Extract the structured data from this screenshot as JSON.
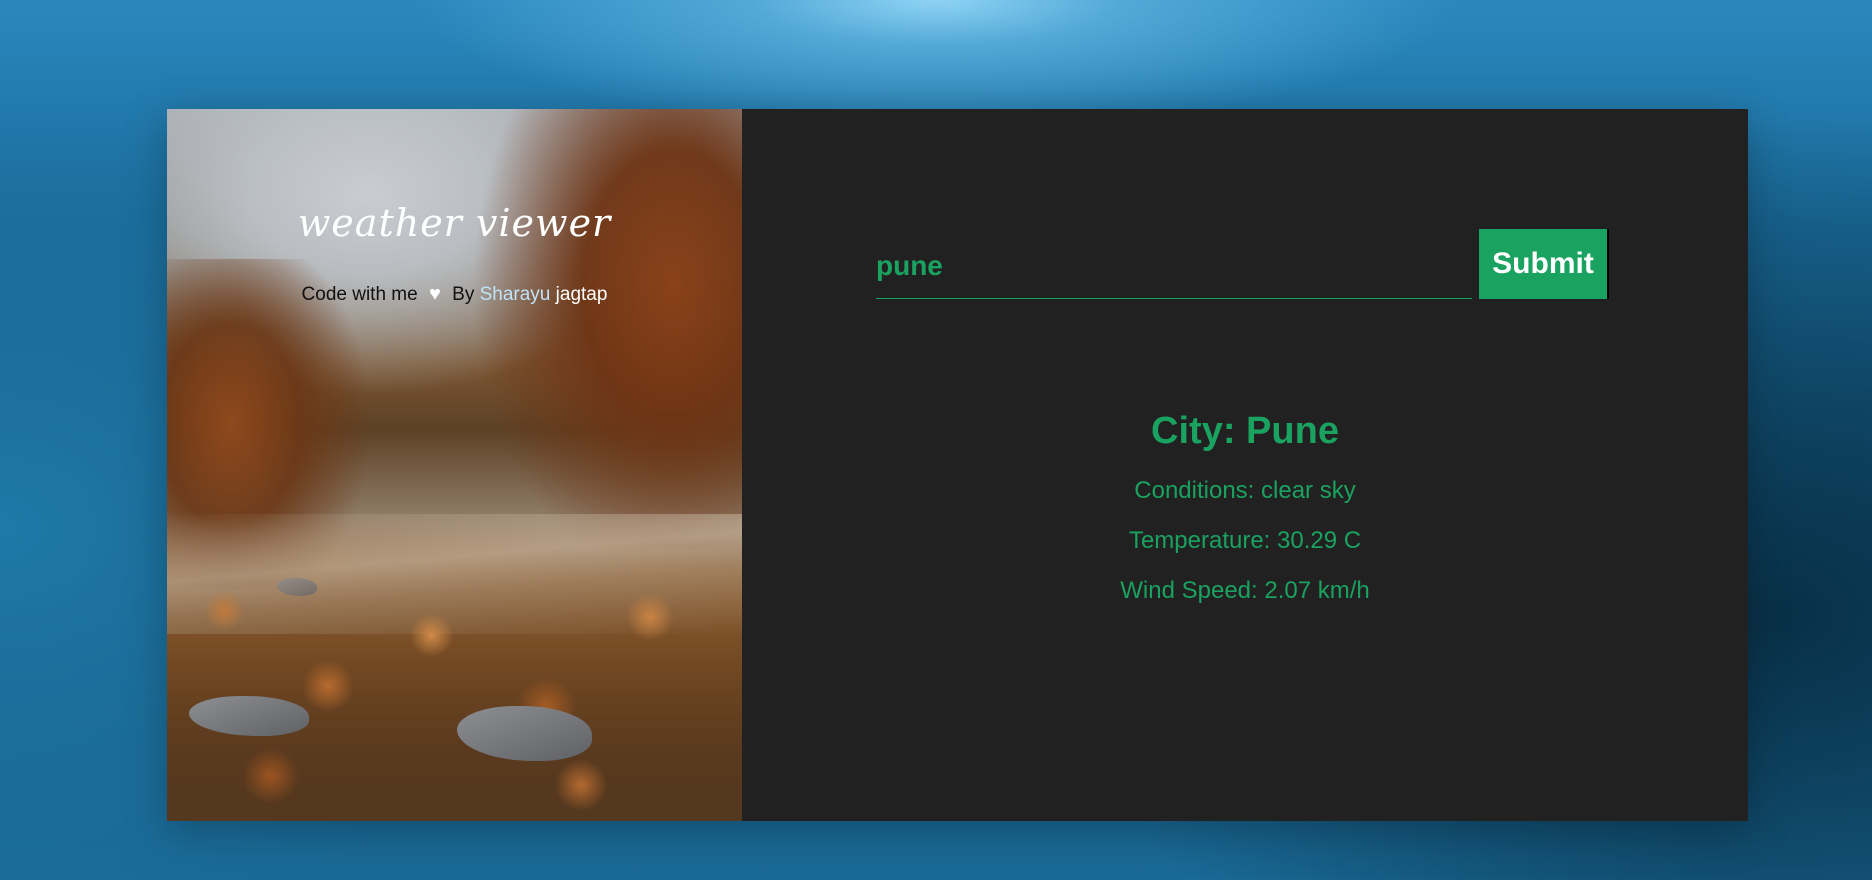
{
  "app": {
    "title": "weather viewer",
    "credit_prefix": "Code with me",
    "credit_by": "By",
    "author_first": "Sharayu",
    "author_last": "jagtap"
  },
  "search": {
    "value": "pune",
    "submit_label": "Submit"
  },
  "result": {
    "city": "City: Pune",
    "conditions": "Conditions: clear sky",
    "temperature": "Temperature: 30.29 C",
    "wind_speed": "Wind Speed: 2.07 km/h"
  },
  "colors": {
    "accent": "#1aa260",
    "panel_bg": "#212121",
    "author_highlight": "#bfe3f7"
  },
  "icons": {
    "credit_icon": "heart-icon"
  }
}
